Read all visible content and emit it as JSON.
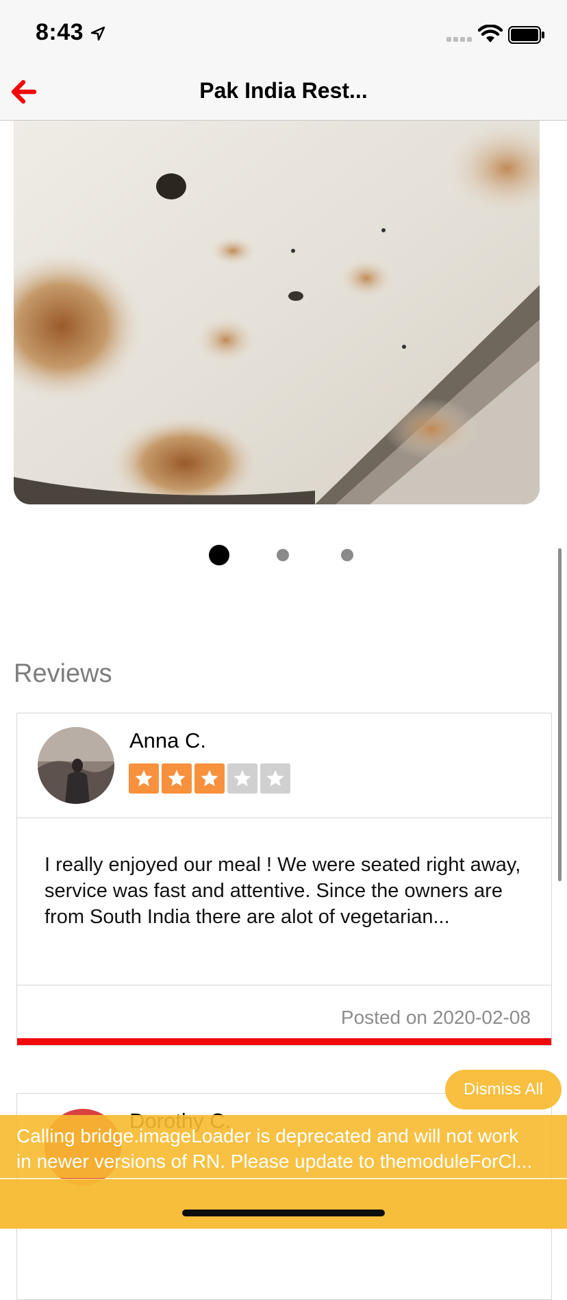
{
  "status_bar": {
    "time": "8:43"
  },
  "nav": {
    "title": "Pak India Rest..."
  },
  "carousel": {
    "page_count": 3,
    "active_index": 0
  },
  "reviews": {
    "heading": "Reviews",
    "items": [
      {
        "name": "Anna C.",
        "rating": 3,
        "max_rating": 5,
        "text": "I really enjoyed our meal ! We were seated right away, service was fast and attentive. Since the owners are from South India there are alot of vegetarian...",
        "posted": "Posted on 2020-02-08"
      },
      {
        "name": "Dorothy C."
      }
    ]
  },
  "warning": {
    "dismiss_label": "Dismiss All",
    "message": "Calling bridge.imageLoader is deprecated and will not work\nin newer versions of RN. Please update to themoduleForCl..."
  },
  "colors": {
    "accent_red": "#f20a0a",
    "star_orange": "#f8913d",
    "warning_yellow": "#f7ba30"
  }
}
